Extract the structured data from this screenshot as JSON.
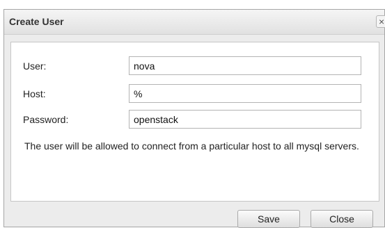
{
  "dialog": {
    "title": "Create User",
    "close_icon_glyph": "×",
    "fields": [
      {
        "label": "User:",
        "value": "nova"
      },
      {
        "label": "Host:",
        "value": "%"
      },
      {
        "label": "Password:",
        "value": "openstack"
      }
    ],
    "note": "The user will be allowed to connect from a particular host to all mysql servers.",
    "buttons": {
      "save": "Save",
      "close": "Close"
    }
  }
}
